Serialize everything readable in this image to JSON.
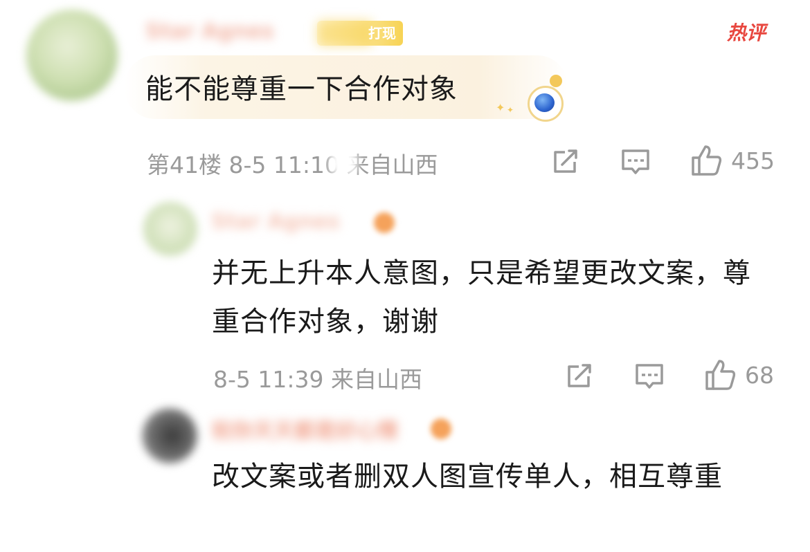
{
  "main_comment": {
    "username": "Star Agnes",
    "badge_text": "打现",
    "hot_tag": "热评",
    "text": "能不能尊重一下合作对象",
    "meta": "第41楼 8-5 11:10 来自山西",
    "like_count": "455"
  },
  "replies": [
    {
      "username": "Star Agnes",
      "text": "并无上升本人意图，只是希望更改文案，尊重合作对象，谢谢",
      "meta": "8-5 11:39 来自山西",
      "like_count": "68"
    },
    {
      "username": "祝你天天都是好心情",
      "text": "改文案或者删双人图宣传单人，相互尊重"
    }
  ],
  "icons": {
    "repost": "repost-icon",
    "comment": "comment-icon",
    "like": "thumbs-up-icon"
  },
  "colors": {
    "meta_text": "#9a9a9a",
    "hot_tag": "#e8473f",
    "bubble": "#fbf1df"
  }
}
